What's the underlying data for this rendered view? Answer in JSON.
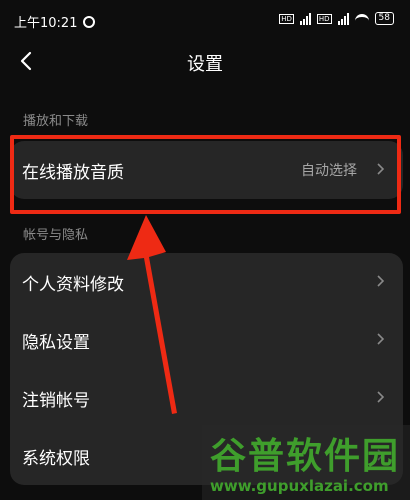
{
  "status_bar": {
    "time": "上午10:21",
    "battery": "58"
  },
  "nav": {
    "title": "设置"
  },
  "sections": [
    {
      "label": "播放和下载",
      "rows": [
        {
          "label": "在线播放音质",
          "value": "自动选择"
        }
      ]
    },
    {
      "label": "帐号与隐私",
      "rows": [
        {
          "label": "个人资料修改"
        },
        {
          "label": "隐私设置"
        },
        {
          "label": "注销帐号"
        },
        {
          "label": "系统权限"
        }
      ]
    }
  ],
  "annotation": {
    "highlight_color": "#ee2a14",
    "arrow_color": "#ee2a14"
  },
  "watermark": {
    "brand": "谷普软件园",
    "url": "www.gupuxlazai.com"
  }
}
